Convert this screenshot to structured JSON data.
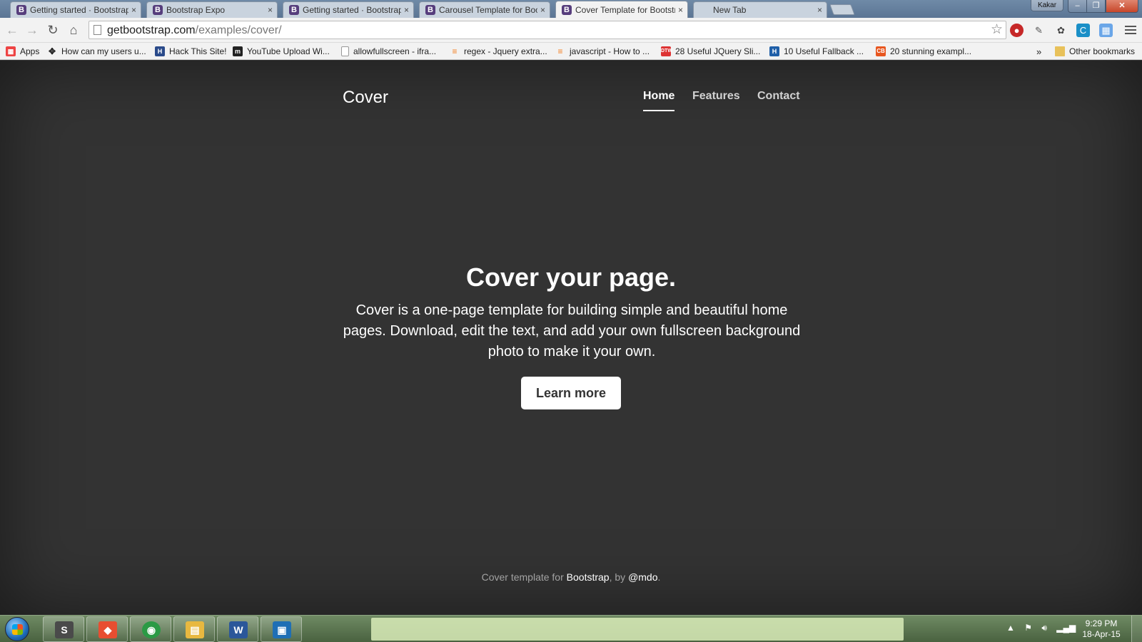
{
  "browser": {
    "tabs": [
      {
        "title": "Getting started · Bootstrap",
        "favicon": "B",
        "active": false
      },
      {
        "title": "Bootstrap Expo",
        "favicon": "B",
        "active": false
      },
      {
        "title": "Getting started · Bootstrap",
        "favicon": "B",
        "active": false
      },
      {
        "title": "Carousel Template for Bootstrap",
        "favicon": "B",
        "active": false
      },
      {
        "title": "Cover Template for Bootstrap",
        "favicon": "B",
        "active": true
      },
      {
        "title": "New Tab",
        "favicon": "",
        "active": false
      }
    ],
    "tab_close_glyph": "×",
    "profile_name": "Kakar",
    "window_controls": {
      "minimize": "–",
      "maximize": "❐",
      "close": "✕"
    },
    "url_host": "getbootstrap.com",
    "url_path": "/examples/cover/",
    "bookmarks": [
      {
        "label": "Apps",
        "icon": "apps-grid-icon",
        "color": "#e44"
      },
      {
        "label": "How can my users u...",
        "icon": "diamond-arrows-icon",
        "color": "#222"
      },
      {
        "label": "Hack This Site!",
        "icon": "hts-icon",
        "color": "#2a4a8a"
      },
      {
        "label": "YouTube Upload Wi...",
        "icon": "m-icon",
        "color": "#222"
      },
      {
        "label": "allowfullscreen - ifra...",
        "icon": "page-icon",
        "color": "#fff"
      },
      {
        "label": "regex - Jquery extra...",
        "icon": "stackoverflow-icon",
        "color": "#f48024"
      },
      {
        "label": "javascript - How to ...",
        "icon": "stackoverflow-icon",
        "color": "#f48024"
      },
      {
        "label": "28 Useful JQuery Sli...",
        "icon": "dtw-icon",
        "color": "#d33"
      },
      {
        "label": "10 Useful Fallback ...",
        "icon": "h-icon",
        "color": "#1f5fa8"
      },
      {
        "label": "20 stunning exampl...",
        "icon": "cb-icon",
        "color": "#e8561f"
      }
    ],
    "bookmarks_overflow": "»",
    "other_bookmarks": "Other bookmarks"
  },
  "page": {
    "brand": "Cover",
    "nav": [
      {
        "label": "Home",
        "active": true
      },
      {
        "label": "Features",
        "active": false
      },
      {
        "label": "Contact",
        "active": false
      }
    ],
    "heading": "Cover your page.",
    "lead": "Cover is a one-page template for building simple and beautiful home pages. Download, edit the text, and add your own fullscreen background photo to make it your own.",
    "button": "Learn more",
    "footer": {
      "prefix": "Cover template for ",
      "link1": "Bootstrap",
      "middle": ", by ",
      "link2": "@mdo",
      "suffix": "."
    }
  },
  "taskbar": {
    "apps": [
      {
        "name": "sublime-text",
        "glyph": "S",
        "color": "#4a4a4a"
      },
      {
        "name": "git",
        "glyph": "◆",
        "color": "#e84e31"
      },
      {
        "name": "chrome",
        "glyph": "◉",
        "color": "#2b9a45"
      },
      {
        "name": "file-explorer",
        "glyph": "▤",
        "color": "#e8b840"
      },
      {
        "name": "word",
        "glyph": "W",
        "color": "#2b579a"
      },
      {
        "name": "app",
        "glyph": "▣",
        "color": "#1f6fb5"
      }
    ],
    "time": "9:29 PM",
    "date": "18-Apr-15"
  },
  "colors": {
    "page_bg": "#333333",
    "bootstrap_purple": "#563d7c",
    "button_bg": "#ffffff",
    "button_text": "#333333"
  }
}
